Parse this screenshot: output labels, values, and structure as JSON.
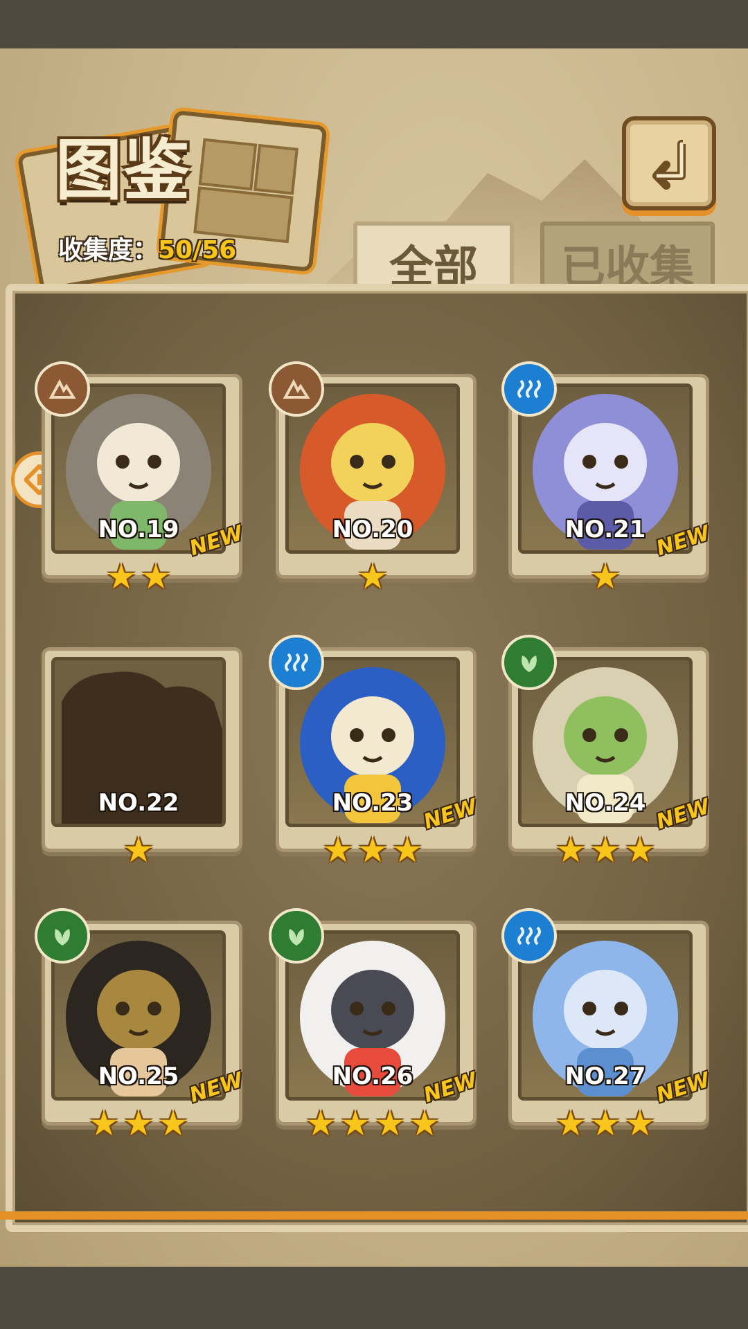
{
  "header": {
    "title": "图鉴",
    "collection_label": "收集度：",
    "collection_value": "50/56"
  },
  "tabs": [
    {
      "label": "全部",
      "active": true
    },
    {
      "label": "已收集",
      "active": false
    }
  ],
  "icons": {
    "back": "return-arrow-icon",
    "side": "diamond-arrow-icon",
    "earth": "earth-element-icon",
    "water": "water-element-icon",
    "grass": "leaf-element-icon",
    "star": "star-icon"
  },
  "colors": {
    "accent_orange": "#e5912a",
    "gold_text": "#f9c418",
    "earth": "#8b5a34",
    "water": "#1d7fd1",
    "grass": "#2e7d32"
  },
  "cards": [
    {
      "number": "NO.19",
      "element": "earth",
      "stars": 2,
      "is_new": true,
      "new_label": "NEW",
      "silhouette": false
    },
    {
      "number": "NO.20",
      "element": "earth",
      "stars": 1,
      "is_new": false,
      "new_label": "",
      "silhouette": false
    },
    {
      "number": "NO.21",
      "element": "water",
      "stars": 1,
      "is_new": true,
      "new_label": "NEW",
      "silhouette": false
    },
    {
      "number": "NO.22",
      "element": "none",
      "stars": 1,
      "is_new": false,
      "new_label": "",
      "silhouette": true
    },
    {
      "number": "NO.23",
      "element": "water",
      "stars": 3,
      "is_new": true,
      "new_label": "NEW",
      "silhouette": false
    },
    {
      "number": "NO.24",
      "element": "grass",
      "stars": 3,
      "is_new": true,
      "new_label": "NEW",
      "silhouette": false
    },
    {
      "number": "NO.25",
      "element": "grass",
      "stars": 3,
      "is_new": true,
      "new_label": "NEW",
      "silhouette": false
    },
    {
      "number": "NO.26",
      "element": "grass",
      "stars": 4,
      "is_new": true,
      "new_label": "NEW",
      "silhouette": false
    },
    {
      "number": "NO.27",
      "element": "water",
      "stars": 3,
      "is_new": true,
      "new_label": "NEW",
      "silhouette": false
    }
  ]
}
